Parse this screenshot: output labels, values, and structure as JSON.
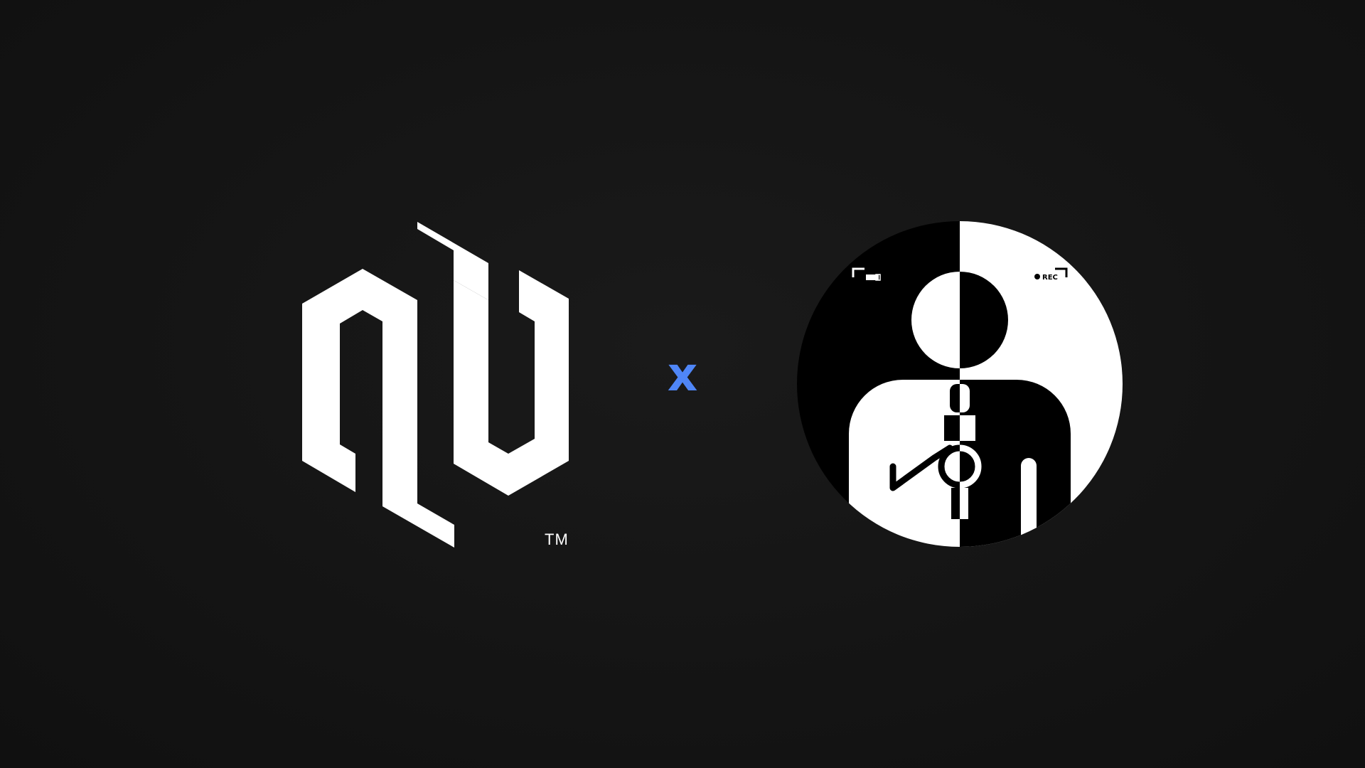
{
  "left_logo": {
    "icon": "hexagon-monogram-icon",
    "trademark": "TM",
    "color": "#ffffff"
  },
  "separator": {
    "symbol": "x",
    "color": "#4f86f7"
  },
  "right_logo": {
    "icon": "split-person-microphone-icon",
    "rec_label": "REC",
    "colors": {
      "dark": "#000000",
      "light": "#ffffff"
    }
  },
  "background_color": "#141414"
}
